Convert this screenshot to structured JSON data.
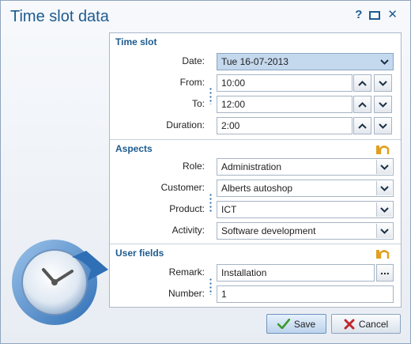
{
  "window": {
    "title": "Time slot data",
    "help_label": "?",
    "close_label": "✕"
  },
  "time_slot": {
    "title": "Time slot",
    "date_label": "Date:",
    "date_value": "Tue 16-07-2013",
    "from_label": "From:",
    "from_value": "10:00",
    "to_label": "To:",
    "to_value": "12:00",
    "duration_label": "Duration:",
    "duration_value": "2:00"
  },
  "aspects": {
    "title": "Aspects",
    "role_label": "Role:",
    "role_value": "Administration",
    "customer_label": "Customer:",
    "customer_value": "Alberts autoshop",
    "product_label": "Product:",
    "product_value": "ICT",
    "activity_label": "Activity:",
    "activity_value": "Software development"
  },
  "user_fields": {
    "title": "User fields",
    "remark_label": "Remark:",
    "remark_value": "Installation",
    "remark_button": "...",
    "number_label": "Number:",
    "number_value": "1"
  },
  "buttons": {
    "save_label": "Save",
    "cancel_label": "Cancel"
  },
  "colors": {
    "accent": "#1d5b8f",
    "selected_field": "#c4d8ee",
    "save_check": "#3b9a2a",
    "cancel_x": "#c0282d"
  },
  "icons": {
    "clock": "clock-refresh-icon",
    "section": "pencil-ruler-icon"
  }
}
